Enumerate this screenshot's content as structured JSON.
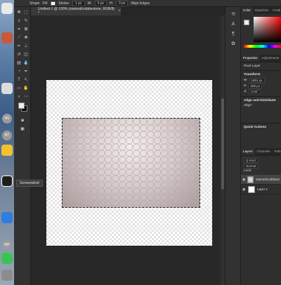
{
  "options_bar": {
    "tool_mode": "Shape",
    "fill_label": "Fill:",
    "stroke_label": "Stroke:",
    "stroke_width": "1 px",
    "w_label": "W:",
    "w_value": "0 px",
    "h_label": "H:",
    "h_value": "0 px",
    "align_edges": "Align Edges"
  },
  "document_tab": {
    "title": "Untitled-1 @ 100% (stained/cobblestone, RGB/8) *",
    "close_icon": "×"
  },
  "tooltip": {
    "text": "Screenshot"
  },
  "dock": {
    "badges": [
      "NV",
      "BT",
      "MP"
    ]
  },
  "panels": {
    "color_tabs": [
      "Color",
      "Swatches",
      "Gradi"
    ],
    "properties_tabs": [
      "Properties",
      "Adjustments"
    ],
    "pixel_layer_label": "Pixel Layer",
    "transform": {
      "title": "Transform",
      "w_label": "W",
      "w_value": "1901 px",
      "h_label": "H",
      "h_value": "808 px",
      "angle_value": "0.00°"
    },
    "align": {
      "title": "Align and Distribute",
      "sub": "Align:"
    },
    "quick_actions": {
      "title": "Quick Actions"
    },
    "layers_tabs": [
      "Layers",
      "Channels",
      "Paths"
    ],
    "layer_filter": "Q Kind",
    "blend_mode": "Normal",
    "lock_label": "Lock:",
    "layers": [
      {
        "name": "stained/cobblestone",
        "selected": true
      },
      {
        "name": "Layer 1",
        "selected": false
      }
    ]
  },
  "colors": {
    "app_bg": "#2b2b2b",
    "panel_bg": "#323232",
    "foreground": "#ededed",
    "background": "#000000"
  }
}
